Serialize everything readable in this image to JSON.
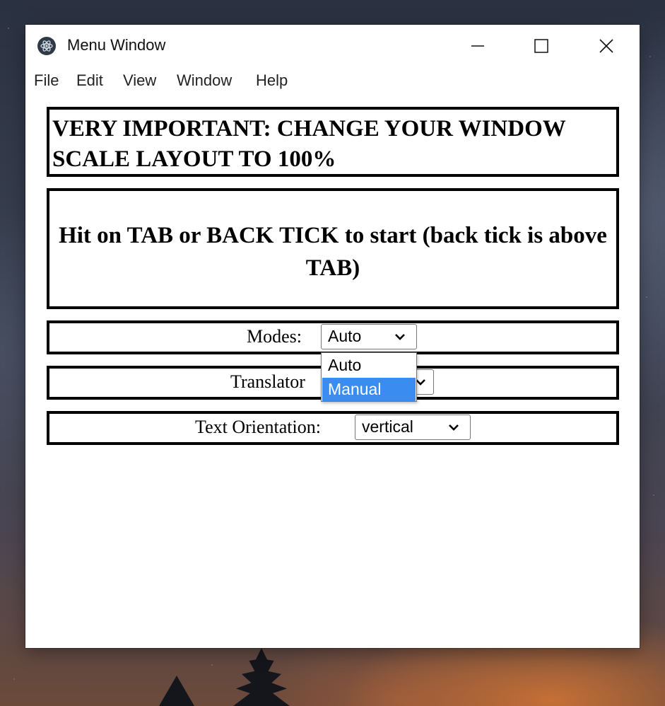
{
  "window": {
    "title": "Menu Window",
    "icon": "app-logo-icon",
    "controls": [
      "minimize-icon",
      "maximize-icon",
      "close-icon"
    ]
  },
  "menubar": {
    "items": [
      {
        "label": "File"
      },
      {
        "label": "Edit"
      },
      {
        "label": "View"
      },
      {
        "label": "Window"
      },
      {
        "label": "Help"
      }
    ]
  },
  "notices": {
    "important": "VERY IMPORTANT: CHANGE YOUR WINDOW SCALE LAYOUT TO 100%",
    "instructions": "Hit on TAB or BACK TICK to start (back tick is above TAB)"
  },
  "settings": {
    "modes": {
      "label": "Modes:",
      "selected": "Auto",
      "options": [
        "Auto",
        "Manual"
      ],
      "highlighted": "Manual",
      "dropdown_open": true
    },
    "translator": {
      "label": "Translator"
    },
    "orientation": {
      "label": "Text Orientation:",
      "selected": "vertical"
    }
  },
  "colors": {
    "highlight": "#3b8cf0",
    "panel_border": "#000000",
    "window_bg": "#ffffff"
  }
}
